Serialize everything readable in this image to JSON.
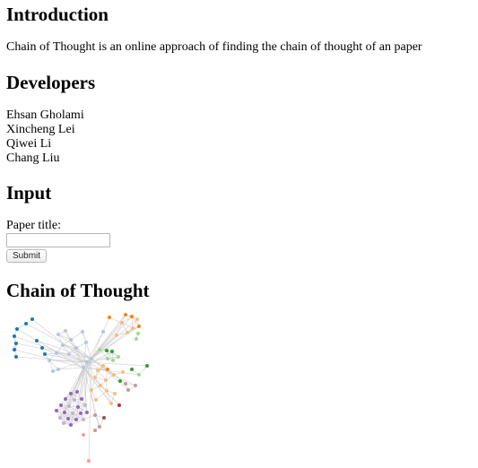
{
  "sections": {
    "introduction": {
      "heading": "Introduction",
      "text": "Chain of Thought is an online approach of finding the chain of thought of an paper"
    },
    "developers": {
      "heading": "Developers",
      "names": [
        "Ehsan Gholami",
        "Xincheng Lei",
        "Qiwei Li",
        "Chang Liu"
      ]
    },
    "input": {
      "heading": "Input",
      "field_label": "Paper title:",
      "field_value": "",
      "submit_label": "Submit"
    },
    "chain": {
      "heading": "Chain of Thought"
    }
  },
  "graph": {
    "description_colors": {
      "edge": "#cccccc",
      "blue": "#1f77b4",
      "light_blue": "#aec7e8",
      "orange": "#ff7f0e",
      "light_orange": "#ffbb78",
      "green": "#2ca02c",
      "light_green": "#98df8a",
      "purple": "#9467bd",
      "light_purple": "#c5b0d5",
      "brown": "#8c564b",
      "pink": "#ff9896",
      "red": "#d62728",
      "light_brown": "#c49c94"
    }
  }
}
